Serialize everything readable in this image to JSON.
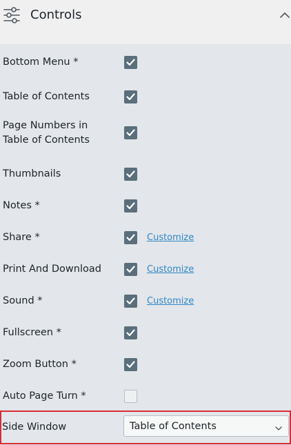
{
  "header": {
    "title": "Controls",
    "icon": "controls-sliders-icon",
    "collapse_icon": "chevron-up-icon"
  },
  "rows": [
    {
      "label": "Bottom Menu *",
      "checked": true
    },
    {
      "label": "Table of Contents",
      "checked": true
    },
    {
      "label_line1": "Page Numbers in",
      "label_line2": "Table of Contents",
      "checked": true
    },
    {
      "label": "Thumbnails",
      "checked": true
    },
    {
      "label": "Notes *",
      "checked": true
    },
    {
      "label": "Share *",
      "checked": true,
      "customize": "Customize"
    },
    {
      "label": "Print And Download",
      "checked": true,
      "customize": "Customize"
    },
    {
      "label": "Sound *",
      "checked": true,
      "customize": "Customize"
    },
    {
      "label": "Fullscreen *",
      "checked": true
    },
    {
      "label": "Zoom Button *",
      "checked": true
    },
    {
      "label": "Auto Page Turn *",
      "checked": false
    }
  ],
  "side_window": {
    "label": "Side Window",
    "selected": "Table of Contents"
  },
  "colors": {
    "checkbox": "#5a6e7b",
    "link": "#2f86c7",
    "highlight_border": "#d92b38"
  }
}
